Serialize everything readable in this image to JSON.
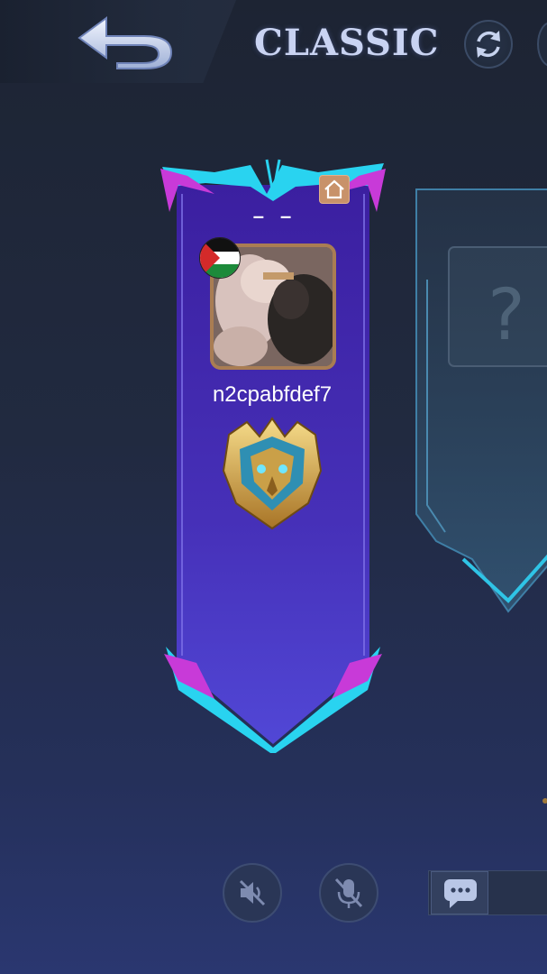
{
  "header": {
    "back_icon": "back-arrow-icon",
    "mode_title": "CLASSIC",
    "refresh_icon": "refresh-icon"
  },
  "player_card": {
    "status": "– –",
    "player_name": "n2cpabfdef7",
    "flag_icon": "palestine-flag-icon",
    "home_icon": "home-icon",
    "rank_icon": "mythic-rank-emblem-icon",
    "colors": {
      "banner_top": "#3b1fa0",
      "banner_bottom": "#5147d6",
      "trim_cyan": "#29d3f0",
      "trim_magenta": "#c83ad8",
      "avatar_border": "#a97d53"
    }
  },
  "empty_slot": {
    "placeholder": "?"
  },
  "controls": {
    "speaker_icon": "speaker-muted-icon",
    "mic_icon": "microphone-muted-icon",
    "chat_icon": "chat-bubble-icon"
  }
}
